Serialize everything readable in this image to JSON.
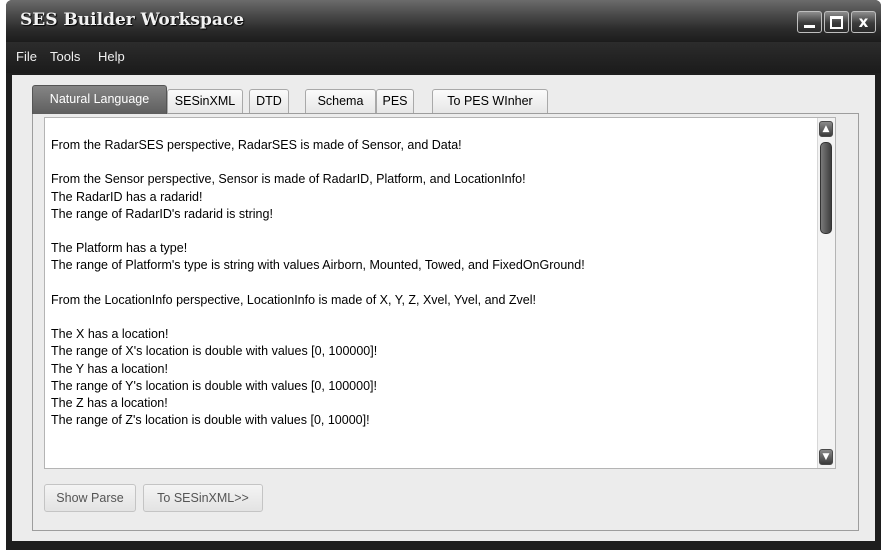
{
  "window": {
    "title": "SES Builder Workspace",
    "controls": {
      "minimize": "",
      "maximize": "",
      "close": "x"
    }
  },
  "menu": {
    "items": [
      "File",
      "Tools",
      "Help"
    ]
  },
  "tabs": [
    {
      "label": "Natural Language",
      "active": true
    },
    {
      "label": "SESinXML",
      "active": false
    },
    {
      "label": "DTD",
      "active": false
    },
    {
      "label": "Schema",
      "active": false
    },
    {
      "label": "PES",
      "active": false
    },
    {
      "label": "To PES WInher",
      "active": false
    }
  ],
  "editor": {
    "content": "From the RadarSES perspective, RadarSES is made of Sensor, and Data!\n\nFrom the Sensor perspective, Sensor is made of RadarID, Platform, and LocationInfo!\nThe RadarID has a radarid!\nThe range of RadarID's radarid is string!\n\nThe Platform has a type!\nThe range of Platform's type is string with values Airborn, Mounted, Towed, and FixedOnGround!\n\nFrom the LocationInfo perspective, LocationInfo is made of X, Y, Z, Xvel, Yvel, and Zvel!\n\nThe X has a location!\nThe range of X's location is double with values [0, 100000]!\nThe Y has a location!\nThe range of Y's location is double with values [0, 100000]!\nThe Z has a location!\nThe range of Z's location is double with values [0, 10000]!"
  },
  "buttons": {
    "show_parse": "Show Parse",
    "to_sesinxml": "To SESinXML>>"
  },
  "colors": {
    "title_bar": "#2b2b2b",
    "active_tab": "#6e6e6e",
    "client_bg": "#ececec"
  }
}
